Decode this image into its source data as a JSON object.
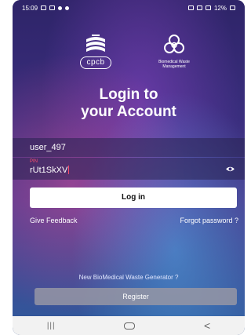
{
  "status_bar": {
    "time": "15:09",
    "battery": "12%"
  },
  "logos": {
    "cpcb_text": "cpcb",
    "bmw_text_1": "Biomedical Waste",
    "bmw_text_2": "Management"
  },
  "title": {
    "line1": "Login to",
    "line2": "your Account"
  },
  "form": {
    "username_value": "user_497",
    "pin_label": "PIN",
    "pin_value": "rUt1SkXV",
    "login_label": "Log in"
  },
  "links": {
    "feedback": "Give Feedback",
    "forgot": "Forgot password ?"
  },
  "register": {
    "prompt": "New BioMedical Waste Generator ?",
    "button_label": "Register"
  },
  "colors": {
    "pin_accent": "#ff4d6d",
    "background_top": "#2e2468",
    "background_bottom": "#2f5b9c"
  }
}
